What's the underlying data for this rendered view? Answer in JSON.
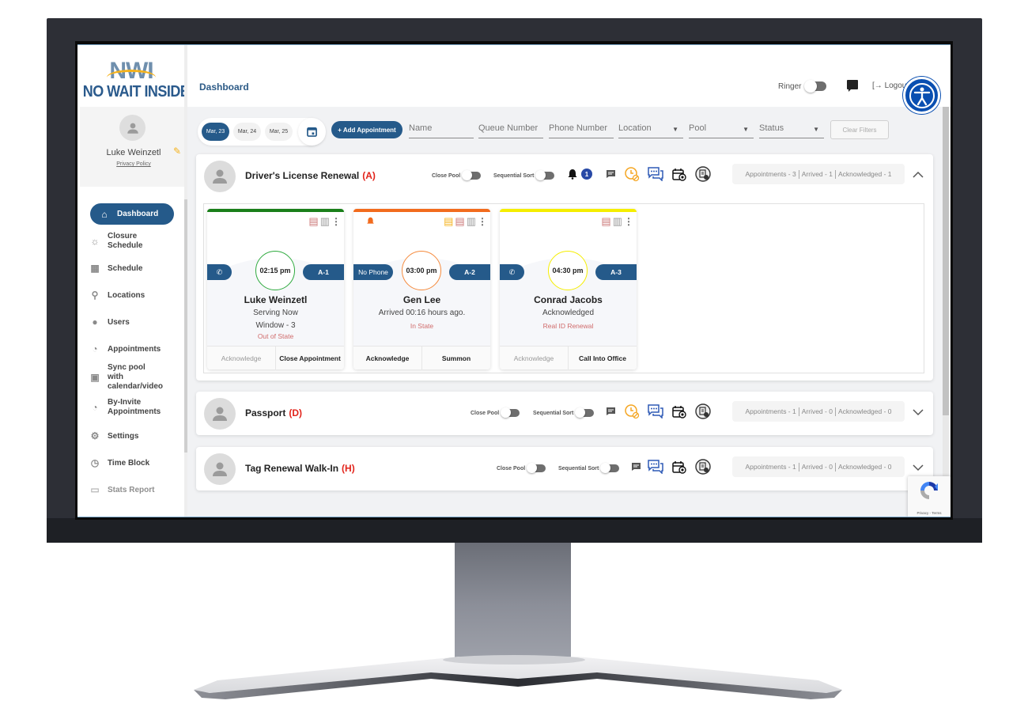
{
  "brand": {
    "logo_mark": "NWI",
    "logo_text": "NO WAIT INSIDE",
    "primary_color": "#255a8a",
    "accent_color": "#f5b21b"
  },
  "profile": {
    "name": "Luke Weinzetl",
    "privacy_link": "Privacy Policy"
  },
  "sidebar": {
    "items": [
      {
        "label": "Dashboard",
        "icon": "home-icon",
        "active": true
      },
      {
        "label": "Closure Schedule",
        "icon": "beach-icon"
      },
      {
        "label": "Schedule",
        "icon": "calendar-icon"
      },
      {
        "label": "Locations",
        "icon": "locations-icon"
      },
      {
        "label": "Users",
        "icon": "user-icon"
      },
      {
        "label": "Appointments",
        "icon": "user-clock-icon"
      },
      {
        "label": "Sync pool with calendar/video",
        "icon": "calendar-sync-icon"
      },
      {
        "label": "By-Invite Appointments",
        "icon": "user-clock-icon"
      },
      {
        "label": "Settings",
        "icon": "gears-icon"
      },
      {
        "label": "Time Block",
        "icon": "clock-icon"
      },
      {
        "label": "Stats Report",
        "icon": "document-icon"
      }
    ]
  },
  "header": {
    "title": "Dashboard",
    "ringer_label": "Ringer",
    "ringer_on": false,
    "logout_label": "Logout"
  },
  "filters": {
    "dates": [
      "Mar, 23",
      "Mar, 24",
      "Mar, 25"
    ],
    "selected_date": "Mar, 23",
    "add_appointment_label": "+ Add Appointment",
    "name_placeholder": "Name",
    "queue_placeholder": "Queue Number",
    "phone_placeholder": "Phone Number",
    "location_placeholder": "Location",
    "pool_placeholder": "Pool",
    "status_placeholder": "Status",
    "clear_label": "Clear Filters"
  },
  "pools": [
    {
      "name": "Driver's License Renewal",
      "code": "(A)",
      "close_pool_label": "Close Pool",
      "sequential_sort_label": "Sequential Sort",
      "notification_count": "1",
      "stats": {
        "appointments": "Appointments - 3",
        "arrived": "Arrived - 1",
        "acknowledged": "Acknowledged - 1"
      },
      "expanded": true,
      "cards": [
        {
          "status_color": "#1a7f1a",
          "phone": "phone-icon",
          "time": "02:15 pm",
          "queue": "A-1",
          "name": "Luke Weinzetl",
          "status": "Serving Now",
          "window": "Window - 3",
          "note": "Out of State",
          "action_left": "Acknowledge",
          "action_right": "Close Appointment"
        },
        {
          "status_color": "#f26b1d",
          "phone": "No Phone",
          "time": "03:00 pm",
          "queue": "A-2",
          "name": "Gen Lee",
          "status": "Arrived 00:16 hours ago.",
          "note": "In State",
          "action_left": "Acknowledge",
          "action_right": "Summon"
        },
        {
          "status_color": "#f5ee00",
          "phone": "phone-icon",
          "time": "04:30 pm",
          "queue": "A-3",
          "name": "Conrad Jacobs",
          "status": "Acknowledged",
          "note": "Real ID Renewal",
          "action_left": "Acknowledge",
          "action_right": "Call Into Office"
        }
      ]
    },
    {
      "name": "Passport",
      "code": "(D)",
      "close_pool_label": "Close Pool",
      "sequential_sort_label": "Sequential Sort",
      "stats": {
        "appointments": "Appointments - 1",
        "arrived": "Arrived - 0",
        "acknowledged": "Acknowledged - 0"
      },
      "expanded": false
    },
    {
      "name": "Tag Renewal Walk-In",
      "code": "(H)",
      "close_pool_label": "Close Pool",
      "sequential_sort_label": "Sequential Sort",
      "stats": {
        "appointments": "Appointments - 1",
        "arrived": "Arrived - 0",
        "acknowledged": "Acknowledged - 0"
      },
      "expanded": false
    }
  ],
  "recaptcha": {
    "label": "Privacy - Terms"
  }
}
